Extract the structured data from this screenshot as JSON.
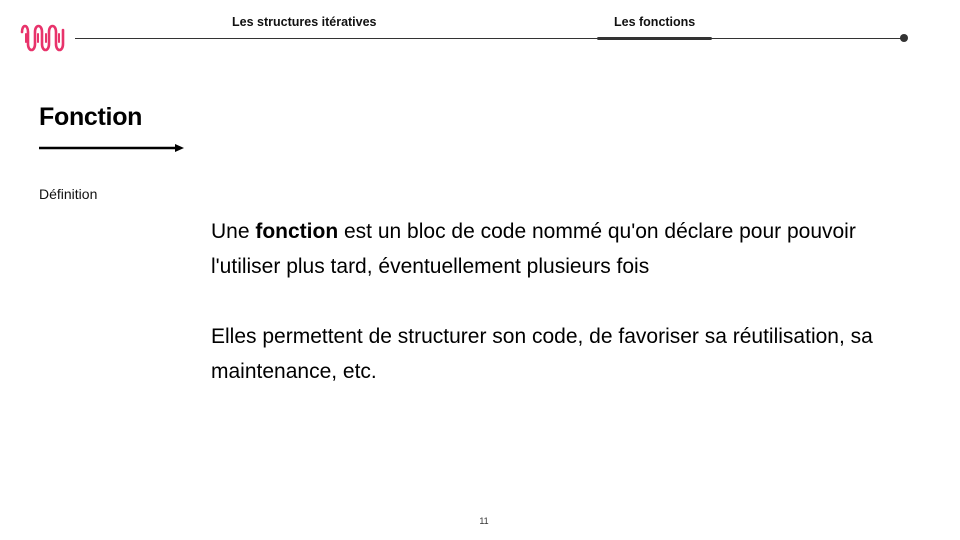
{
  "brand": {
    "accent_color": "#e8336b",
    "logo_icon": "wave-logo-icon"
  },
  "nav": {
    "items": [
      {
        "label": "Les structures itératives",
        "active": false
      },
      {
        "label": "Les fonctions",
        "active": true
      }
    ],
    "line_color": "#333333"
  },
  "slide": {
    "title": "Fonction",
    "section_label": "Définition",
    "paragraph1": {
      "before": "Une ",
      "term": "fonction",
      "after": " est un bloc de code nommé qu'on déclare pour pouvoir l'utiliser plus tard, éventuellement plusieurs fois"
    },
    "paragraph2": "Elles permettent de structurer son code, de favoriser sa réutilisation, sa maintenance, etc.",
    "page_number": "11"
  }
}
